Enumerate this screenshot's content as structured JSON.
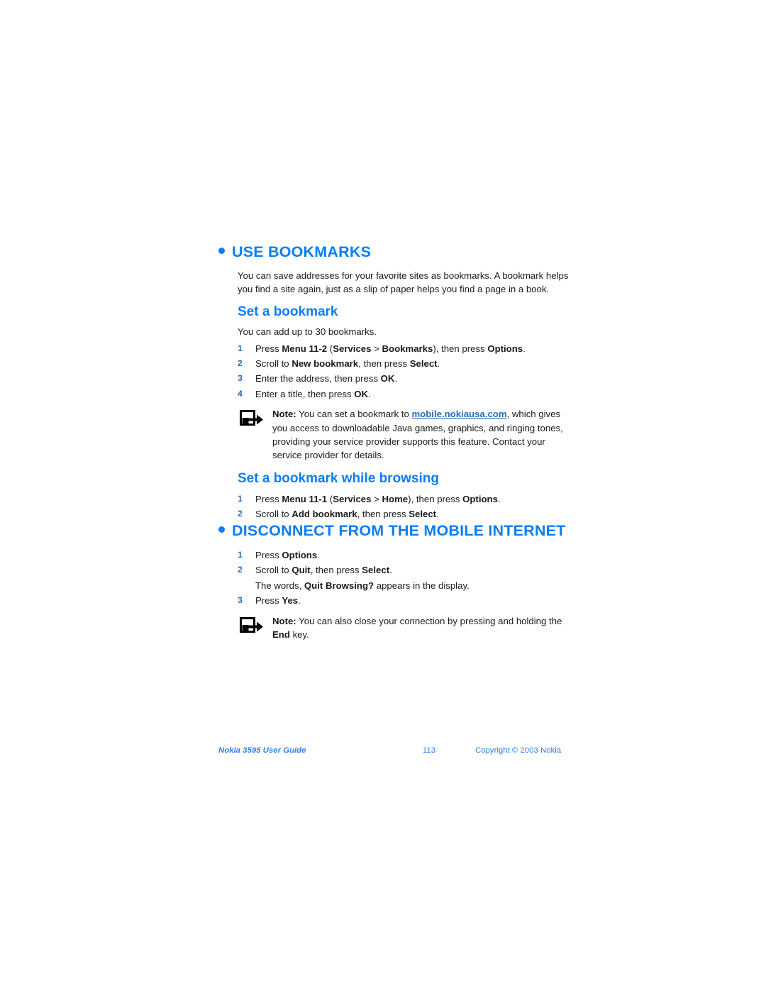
{
  "document": {
    "sections": [
      {
        "kind": "section-heading",
        "title": "USE BOOKMARKS",
        "bullet_icon": "bullet-dot-icon"
      },
      {
        "kind": "paragraph",
        "text": "You can save addresses for your favorite sites as bookmarks. A bookmark helps you find a site again, just as a slip of paper helps you find a page in a book."
      },
      {
        "kind": "sub-heading",
        "title": "Set a bookmark"
      },
      {
        "kind": "paragraph",
        "text": "You can add up to 30 bookmarks."
      },
      {
        "kind": "steps",
        "items": [
          {
            "number": "1",
            "parts": [
              {
                "t": "Press ",
                "b": false
              },
              {
                "t": "Menu 11-2",
                "b": true
              },
              {
                "t": " (",
                "b": false
              },
              {
                "t": "Services",
                "b": true
              },
              {
                "t": " > ",
                "b": false
              },
              {
                "t": "Bookmarks",
                "b": true
              },
              {
                "t": "), then press ",
                "b": false
              },
              {
                "t": "Options",
                "b": true
              },
              {
                "t": ".",
                "b": false
              }
            ]
          },
          {
            "number": "2",
            "parts": [
              {
                "t": "Scroll to ",
                "b": false
              },
              {
                "t": "New bookmark",
                "b": true
              },
              {
                "t": ", then press ",
                "b": false
              },
              {
                "t": "Select",
                "b": true
              },
              {
                "t": ".",
                "b": false
              }
            ]
          },
          {
            "number": "3",
            "parts": [
              {
                "t": "Enter the address, then press ",
                "b": false
              },
              {
                "t": "OK",
                "b": true
              },
              {
                "t": ".",
                "b": false
              }
            ]
          },
          {
            "number": "4",
            "parts": [
              {
                "t": "Enter a title, then press ",
                "b": false
              },
              {
                "t": "OK",
                "b": true
              },
              {
                "t": ".",
                "b": false
              }
            ]
          }
        ]
      },
      {
        "kind": "note",
        "icon": "note-arrow-icon",
        "parts": [
          {
            "t": "Note:",
            "b": true
          },
          {
            "t": " You can set a bookmark to ",
            "b": false
          },
          {
            "t": "mobile.nokiausa.com",
            "link": true
          },
          {
            "t": ", which gives you access to downloadable Java games, graphics, and ringing tones, providing your service provider supports this feature. Contact your service provider for details.",
            "b": false
          }
        ]
      },
      {
        "kind": "sub-heading",
        "title": "Set a bookmark while browsing"
      },
      {
        "kind": "steps",
        "items": [
          {
            "number": "1",
            "parts": [
              {
                "t": "Press ",
                "b": false
              },
              {
                "t": "Menu 11-1",
                "b": true
              },
              {
                "t": " (",
                "b": false
              },
              {
                "t": "Services",
                "b": true
              },
              {
                "t": " > ",
                "b": false
              },
              {
                "t": "Home",
                "b": true
              },
              {
                "t": "), then press ",
                "b": false
              },
              {
                "t": "Options",
                "b": true
              },
              {
                "t": ".",
                "b": false
              }
            ]
          },
          {
            "number": "2",
            "parts": [
              {
                "t": "Scroll to ",
                "b": false
              },
              {
                "t": "Add bookmark",
                "b": true
              },
              {
                "t": ", then press ",
                "b": false
              },
              {
                "t": "Select",
                "b": true
              },
              {
                "t": ".",
                "b": false
              }
            ]
          }
        ]
      },
      {
        "kind": "section-heading",
        "title": "DISCONNECT FROM THE MOBILE INTERNET",
        "bullet_icon": "bullet-dot-icon"
      },
      {
        "kind": "steps",
        "items": [
          {
            "number": "1",
            "parts": [
              {
                "t": "Press ",
                "b": false
              },
              {
                "t": "Options",
                "b": true
              },
              {
                "t": ".",
                "b": false
              }
            ]
          },
          {
            "number": "2",
            "parts": [
              {
                "t": "Scroll to ",
                "b": false
              },
              {
                "t": "Quit",
                "b": true
              },
              {
                "t": ", then press ",
                "b": false
              },
              {
                "t": "Select",
                "b": true
              },
              {
                "t": ".",
                "b": false
              }
            ]
          },
          {
            "continuation": true,
            "parts": [
              {
                "t": "The words, ",
                "b": false
              },
              {
                "t": "Quit Browsing?",
                "b": true
              },
              {
                "t": " appears in the display.",
                "b": false
              }
            ]
          },
          {
            "number": "3",
            "parts": [
              {
                "t": "Press ",
                "b": false
              },
              {
                "t": "Yes",
                "b": true
              },
              {
                "t": ".",
                "b": false
              }
            ]
          }
        ]
      },
      {
        "kind": "note",
        "icon": "note-arrow-icon",
        "parts": [
          {
            "t": "Note:",
            "b": true
          },
          {
            "t": " You can also close your connection by pressing and holding the ",
            "b": false
          },
          {
            "t": "End",
            "b": true
          },
          {
            "t": " key.",
            "b": false
          }
        ]
      }
    ]
  },
  "footer": {
    "guide_title": "Nokia 3595 User Guide",
    "page_number": "113",
    "copyright": "Copyright © 2003 Nokia"
  },
  "colors": {
    "heading_blue": "#0b7ef4",
    "step_number_blue": "#2e6db4",
    "link_blue": "#2e6db4",
    "footer_blue": "#2f7ef0",
    "body_text": "#1a1a1a",
    "page_background": "#ffffff"
  }
}
